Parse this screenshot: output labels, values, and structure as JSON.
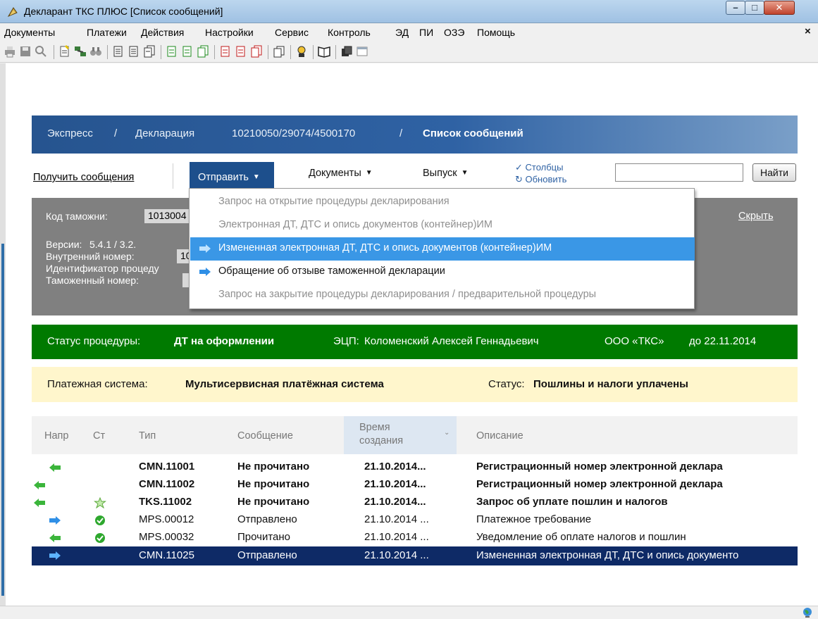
{
  "window": {
    "title": "Декларант ТКС ПЛЮС [Список сообщений]"
  },
  "menu": [
    "Документы",
    "Платежи",
    "Действия",
    "Настройки",
    "Сервис",
    "Контроль",
    "ЭД",
    "ПИ",
    "ОЗЭ",
    "Помощь"
  ],
  "breadcrumb": {
    "home": "Экспресс",
    "sep": "/",
    "decl_label": "Декларация",
    "decl_number": "10210050/29074/4500170",
    "current": "Список сообщений"
  },
  "actions": {
    "get_messages": "Получить сообщения",
    "send": "Отправить",
    "documents": "Документы",
    "release": "Выпуск",
    "columns": "✓ Столбцы",
    "refresh": "↻ Обновить",
    "search_value": "",
    "find": "Найти"
  },
  "info": {
    "customs_code_label": "Код таможни:",
    "customs_code_value": "1013004",
    "hide": "Скрыть",
    "versions_label": "Версии:",
    "versions_value": "5.4.1  /  3.2.",
    "internal_number_label": "Внутренний номер:",
    "internal_number_value": "10",
    "procedure_id_label": "Идентификатор процеду",
    "customs_number_label": "Таможенный номер:"
  },
  "status": {
    "procedure_label": "Статус процедуры:",
    "procedure_value": "ДТ на оформлении",
    "ecp_label": "ЭЦП:",
    "ecp_value": "Коломенский Алексей Геннадьевич",
    "org": "ООО «ТКС»",
    "valid_until": "до 22.11.2014"
  },
  "payment": {
    "system_label": "Платежная система:",
    "system_value": "Мультисервисная платёжная система",
    "status_label": "Статус:",
    "status_value": "Пошлины и налоги уплачены"
  },
  "table": {
    "headers": {
      "dir": "Напр",
      "st": "Ст",
      "type": "Тип",
      "message": "Сообщение",
      "time_line1": "Время",
      "time_line2": "создания",
      "description": "Описание"
    },
    "rows": [
      {
        "dir": "in",
        "st": "",
        "type": "CMN.11001",
        "message": "Не прочитано",
        "time": "21.10.2014...",
        "description": "Регистрационный номер электронной деклара",
        "bold": true
      },
      {
        "dir": "in",
        "st": "",
        "type": "CMN.11002",
        "message": "Не прочитано",
        "time": "21.10.2014...",
        "description": "Регистрационный номер электронной деклара",
        "bold": true
      },
      {
        "dir": "in",
        "st": "star",
        "type": "TKS.11002",
        "message": "Не прочитано",
        "time": "21.10.2014...",
        "description": "Запрос об уплате пошлин и налогов",
        "bold": true
      },
      {
        "dir": "out",
        "st": "ok",
        "type": "MPS.00012",
        "message": "Отправлено",
        "time": "21.10.2014 ...",
        "description": "Платежное требование",
        "bold": false
      },
      {
        "dir": "in",
        "st": "ok",
        "type": "MPS.00032",
        "message": "Прочитано",
        "time": "21.10.2014 ...",
        "description": "Уведомление об оплате налогов и пошлин",
        "bold": false
      },
      {
        "dir": "out",
        "st": "",
        "type": "CMN.11025",
        "message": "Отправлено",
        "time": "21.10.2014 ...",
        "description": "Измененная электронная ДТ, ДТС и опись документо",
        "bold": false,
        "selected": true
      }
    ]
  },
  "send_menu": [
    {
      "label": "Запрос на открытие процедуры декларирования",
      "enabled": false,
      "icon": false
    },
    {
      "label": "Электронная ДТ, ДТС и опись документов (контейнер)ИМ",
      "enabled": false,
      "icon": false
    },
    {
      "label": "Измененная электронная ДТ, ДТС и опись документов (контейнер)ИМ",
      "enabled": true,
      "icon": true,
      "highlighted": true
    },
    {
      "label": "Обращение об отзыве таможенной декларации",
      "enabled": true,
      "icon": true
    },
    {
      "label": "Запрос на закрытие процедуры декларирования / предварительной процедуры",
      "enabled": false,
      "icon": false
    }
  ],
  "colors": {
    "header_blue": "#26548f",
    "status_green": "#007a00",
    "payment_yellow": "#fff6cc",
    "selection": "#0e2a66",
    "menu_highlight": "#3a97e6"
  }
}
